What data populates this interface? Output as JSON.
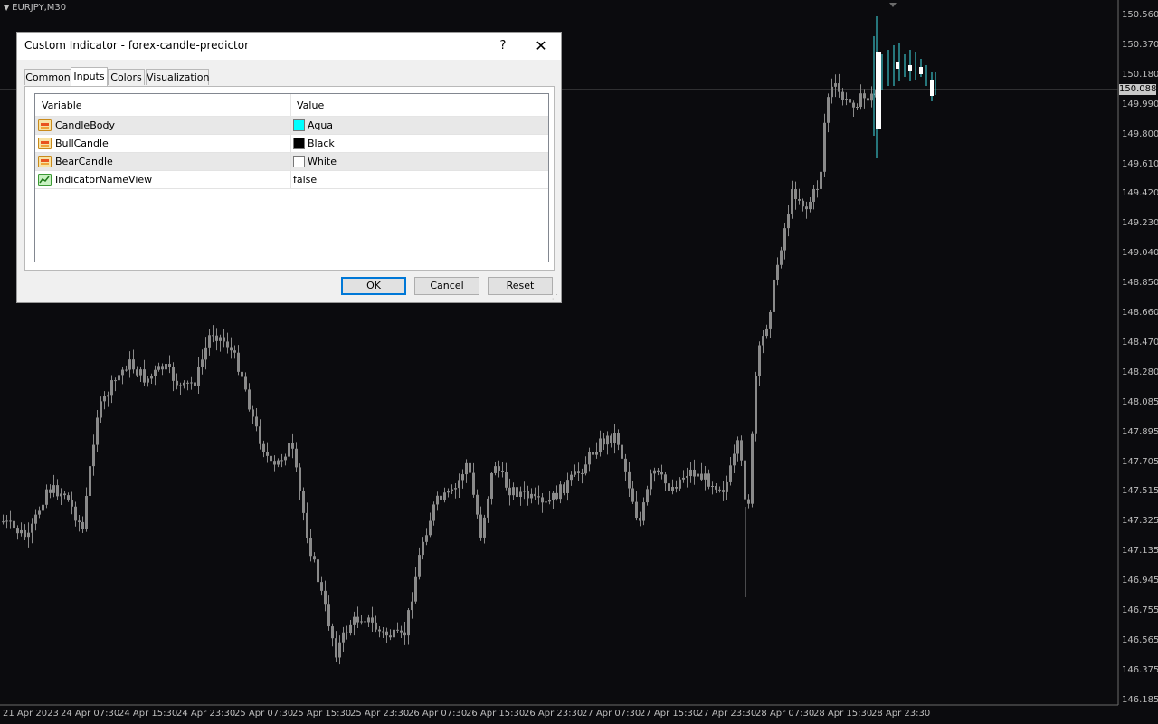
{
  "window": {
    "symbol": "EURJPY,M30"
  },
  "price_axis": {
    "labels": [
      "150.560",
      "150.370",
      "150.180",
      "149.990",
      "149.800",
      "149.610",
      "149.420",
      "149.230",
      "149.040",
      "148.850",
      "148.660",
      "148.470",
      "148.280",
      "148.085",
      "147.895",
      "147.705",
      "147.515",
      "147.325",
      "147.135",
      "146.945",
      "146.755",
      "146.565",
      "146.375",
      "146.185"
    ],
    "current_price": "150.088",
    "colors": {
      "axis_text": "#bdbdbd",
      "current_bg": "#c8c8c8"
    }
  },
  "time_axis": {
    "labels": [
      "21 Apr 2023",
      "24 Apr 07:30",
      "24 Apr 15:30",
      "24 Apr 23:30",
      "25 Apr 07:30",
      "25 Apr 15:30",
      "25 Apr 23:30",
      "26 Apr 07:30",
      "26 Apr 15:30",
      "26 Apr 23:30",
      "27 Apr 07:30",
      "27 Apr 15:30",
      "27 Apr 23:30",
      "28 Apr 07:30",
      "28 Apr 15:30",
      "28 Apr 23:30"
    ]
  },
  "chart_colors": {
    "background": "#0b0b0e",
    "candle": "#8a8a8a",
    "predictor": "#40e0e8",
    "predictor_body": "#ffffff"
  },
  "dialog": {
    "title": "Custom Indicator - forex-candle-predictor",
    "help_symbol": "?",
    "close_symbol": "✕",
    "tabs": [
      {
        "label": "Common",
        "active": false
      },
      {
        "label": "Inputs",
        "active": true
      },
      {
        "label": "Colors",
        "active": false
      },
      {
        "label": "Visualization",
        "active": false
      }
    ],
    "grid": {
      "headers": {
        "variable": "Variable",
        "value": "Value"
      },
      "rows": [
        {
          "variable": "CandleBody",
          "value": "Aqua",
          "swatch": "#00ffff",
          "icon": "color-param-icon"
        },
        {
          "variable": "BullCandle",
          "value": "Black",
          "swatch": "#000000",
          "icon": "color-param-icon"
        },
        {
          "variable": "BearCandle",
          "value": "White",
          "swatch": "#ffffff",
          "icon": "color-param-icon"
        },
        {
          "variable": "IndicatorNameView",
          "value": "false",
          "icon": "bool-param-icon"
        }
      ]
    },
    "buttons": {
      "ok": "OK",
      "cancel": "Cancel",
      "reset": "Reset"
    }
  }
}
